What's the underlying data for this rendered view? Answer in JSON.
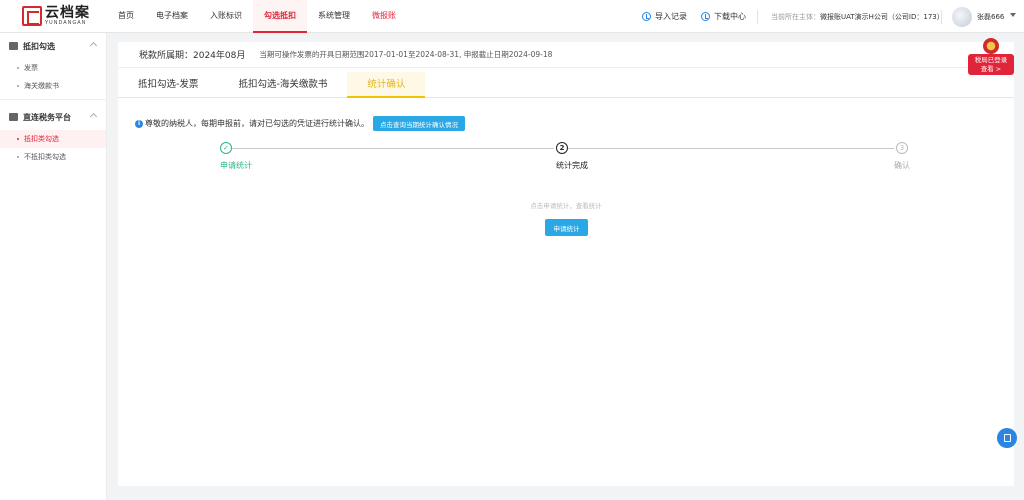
{
  "header": {
    "logo_cn": "云档案",
    "logo_en": "YUNDANGAN",
    "nav": [
      "首页",
      "电子档案",
      "入账标识",
      "勾选抵扣",
      "系统管理",
      "微报账"
    ],
    "active_nav": 3,
    "import_label": "导入记录",
    "download_label": "下载中心",
    "entity_label": "当前所在主体：",
    "entity_value": "微报账UAT演示H公司（公司ID：173）",
    "username": "张磊666"
  },
  "sidebar": {
    "groups": [
      {
        "title": "抵扣勾选",
        "items": [
          "发票",
          "海关缴款书"
        ]
      },
      {
        "title": "直连税务平台",
        "items": [
          "抵扣类勾选",
          "不抵扣类勾选"
        ]
      }
    ],
    "active_item": "抵扣类勾选"
  },
  "main": {
    "period": "税款所属期：2024年08月",
    "range": "当期可操作发票的开具日期范围2017-01-01至2024-08-31, 申报截止日期2024-09-18",
    "tabs": [
      "抵扣勾选-发票",
      "抵扣勾选-海关缴款书",
      "统计确认"
    ],
    "active_tab": 2,
    "notice_icon": "i",
    "notice": "尊敬的纳税人，每期申报前，请对已勾选的凭证进行统计确认。",
    "notice_button": "点击查询当期统计确认情况",
    "steps": [
      {
        "num": "1",
        "label": "申请统计",
        "state": "done"
      },
      {
        "num": "2",
        "label": "统计完成",
        "state": "current"
      },
      {
        "num": "3",
        "label": "确认",
        "state": "pending"
      }
    ],
    "hint": "点击申请统计，查看统计",
    "apply_button": "申请统计"
  },
  "float_badge": {
    "line1": "税局已登录",
    "line2": "查看 >"
  },
  "colors": {
    "brand_red": "#e0253a",
    "primary_blue": "#2aa8e6",
    "done_green": "#29b68a",
    "tab_yellow": "#f0c400"
  }
}
